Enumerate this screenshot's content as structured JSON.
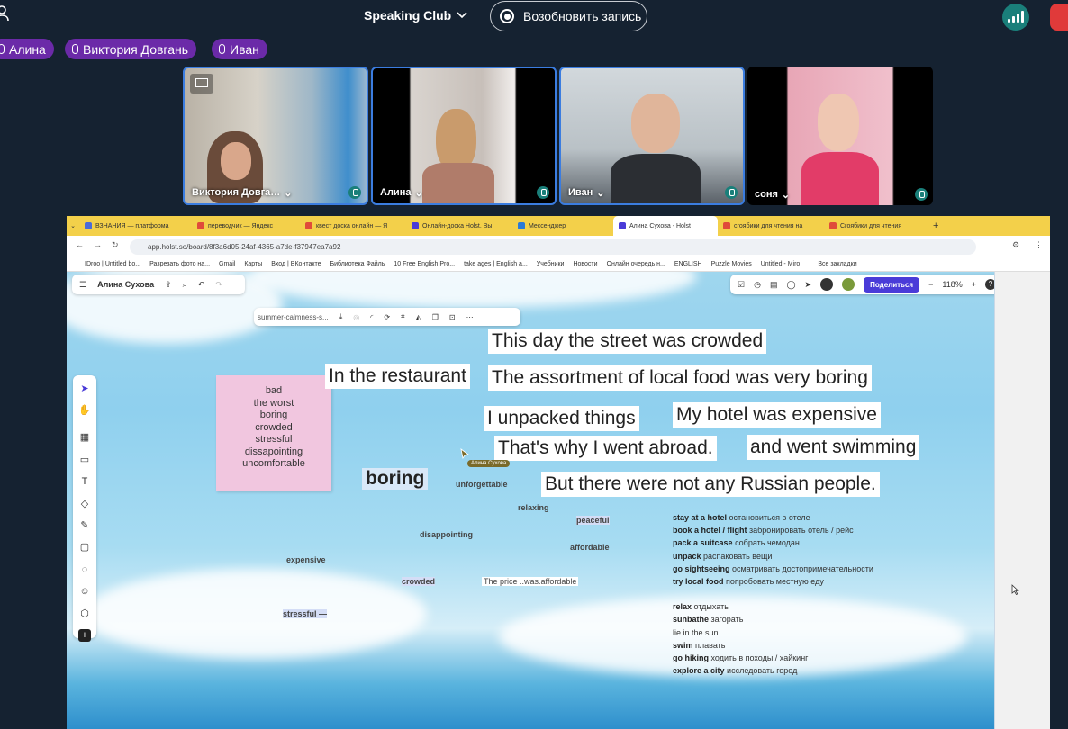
{
  "header": {
    "club_title": "Speaking Club",
    "resume_label": "Возобновить запись"
  },
  "speakers": [
    "Алина",
    "Виктория Довгань",
    "Иван"
  ],
  "tiles": [
    {
      "name": "Виктория Довга…"
    },
    {
      "name": "Алина"
    },
    {
      "name": "Иван"
    },
    {
      "name": "соня"
    }
  ],
  "browser": {
    "tabs": [
      "ВЗНАНИЯ — платформа",
      "переводчик — Яндекс",
      "квест доска онлайн — Я",
      "Онлайн-доска Holst. Вы",
      "Мессенджер",
      "Алина Сухова - Holst",
      "сгоябики для чтения на",
      "Сгоябики для чтения"
    ],
    "url": "app.holst.so/board/8f3a6d05-24af-4365-a7de-f37947ea7a92",
    "bookmarks": [
      "IDroo | Untitled bo...",
      "Разрезать фото на...",
      "Gmail",
      "Карты",
      "Вход | ВКонтакте",
      "Библиотека Файль",
      "10 Free English Pro...",
      "take ages | English a...",
      "Учебники",
      "Новости",
      "Онлайн очередь н...",
      "ENGLISH",
      "Puzzle Movies",
      "Untitled - Miro"
    ],
    "bookmarks_all": "Все закладки"
  },
  "board": {
    "owner": "Алина Сухова",
    "file_label": "summer-calmness-s...",
    "share_label": "Поделиться",
    "zoom": "118%",
    "sticky": [
      "bad",
      "the worst",
      "boring",
      "crowded",
      "stressful",
      "dissapointing",
      "uncomfortable"
    ],
    "sentences": {
      "s1": "This day the street was crowded",
      "s2": "In the restaurant",
      "s3": "The assortment of local food was very boring",
      "s4": "I unpacked things",
      "s5": "My hotel was expensive",
      "s6": "That's why I went abroad.",
      "s7": "and went swimming",
      "s8": "But there were not any Russian people."
    },
    "words": {
      "boring": "boring",
      "unforgettable": "unforgettable",
      "relaxing": "relaxing",
      "peaceful": "peaceful",
      "disappointing": "disappointing",
      "affordable": "affordable",
      "expensive": "expensive",
      "crowded": "crowded",
      "price": "The price ..was.affordable",
      "stressful": "stressful —"
    },
    "cursor_label": "Алина Сухова",
    "vocab": [
      {
        "en": "stay at a hotel",
        "ru": "остановиться в отеле"
      },
      {
        "en": "book a hotel / flight",
        "ru": "забронировать отель / рейс"
      },
      {
        "en": "pack a suitcase",
        "ru": "собрать чемодан"
      },
      {
        "en": "unpack",
        "ru": "распаковать вещи"
      },
      {
        "en": "go sightseeing",
        "ru": "осматривать достопримечательности"
      },
      {
        "en": "try local food",
        "ru": "попробовать местную еду"
      },
      {
        "en": "",
        "ru": ""
      },
      {
        "en": "relax",
        "ru": "отдыхать"
      },
      {
        "en": "sunbathe",
        "ru": "загорать"
      },
      {
        "en": "lie in the sun",
        "ru": ""
      },
      {
        "en": "swim",
        "ru": "плавать"
      },
      {
        "en": "go hiking",
        "ru": "ходить в походы / хайкинг"
      },
      {
        "en": "explore a city",
        "ru": "исследовать город"
      }
    ]
  },
  "colors": {
    "accent": "#6b2aa8",
    "tile_border": "#3b7de0",
    "share": "#4a3bd8",
    "sticky": "#f1c6df"
  }
}
